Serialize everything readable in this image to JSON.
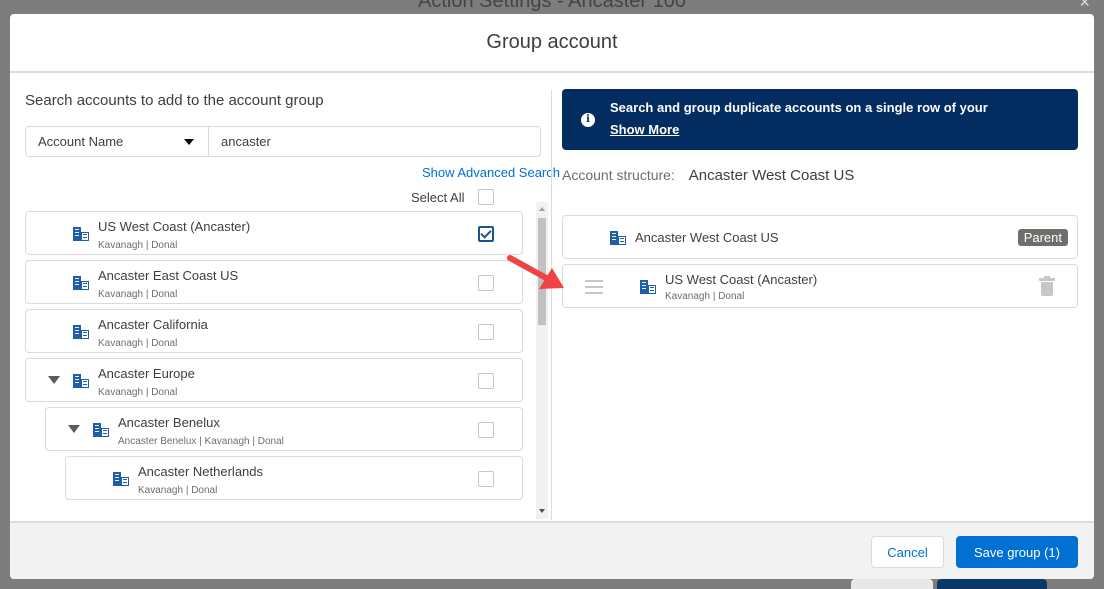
{
  "backdrop": {
    "title": "Action Settings - Ancaster 100",
    "close_glyph": "×"
  },
  "modal": {
    "title": "Group account",
    "left_panel": {
      "title": "Search accounts to add to the account group",
      "field_select_value": "Account Name",
      "search_value": "ancaster",
      "advanced_search_label": "Show Advanced Search",
      "select_all_label": "Select All",
      "results": [
        {
          "name": "US West Coast (Ancaster)",
          "sub": "Kavanagh | Donal",
          "checked": true,
          "expandable": false,
          "level": 0
        },
        {
          "name": "Ancaster East Coast US",
          "sub": "Kavanagh | Donal",
          "checked": false,
          "expandable": false,
          "level": 0
        },
        {
          "name": "Ancaster California",
          "sub": "Kavanagh | Donal",
          "checked": false,
          "expandable": false,
          "level": 0
        },
        {
          "name": "Ancaster Europe",
          "sub": "Kavanagh | Donal",
          "checked": false,
          "expandable": true,
          "level": 0
        },
        {
          "name": "Ancaster Benelux",
          "sub": "Ancaster Benelux | Kavanagh | Donal",
          "checked": false,
          "expandable": true,
          "level": 1
        },
        {
          "name": "Ancaster Netherlands",
          "sub": "Kavanagh | Donal",
          "checked": false,
          "expandable": false,
          "level": 2
        }
      ]
    },
    "right_panel": {
      "banner_message": "Search and group duplicate accounts on a single row of your",
      "banner_show_more": "Show More",
      "banner_icon": "info-icon",
      "structure_label": "Account structure:",
      "structure_value": "Ancaster West Coast US",
      "parent": {
        "name": "Ancaster West Coast US",
        "badge": "Parent"
      },
      "child": {
        "name": "US West Coast (Ancaster)",
        "sub": "Kavanagh | Donal"
      }
    },
    "footer": {
      "cancel_label": "Cancel",
      "save_label": "Save group (1)"
    }
  },
  "colors": {
    "brand": "#0070d2",
    "banner": "#032d60",
    "account_icon": "#1f5fa8",
    "annotation_arrow": "#ef4443"
  }
}
